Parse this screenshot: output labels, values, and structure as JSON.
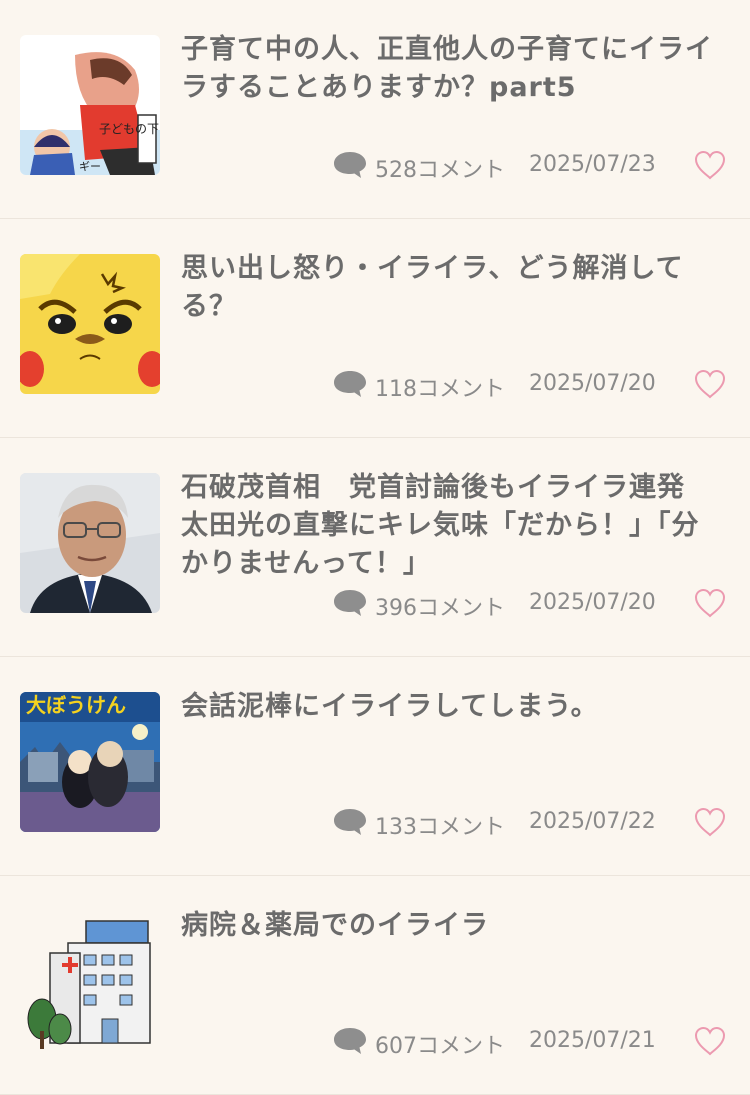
{
  "topics": [
    {
      "title": "子育て中の人、正直他人の子育てにイライラすることありますか？part5",
      "comments": "528コメント",
      "date": "2025/07/23",
      "thumbnail": "manga-illustration",
      "thumb_text": "子どもの下ネタに"
    },
    {
      "title": "思い出し怒り・イライラ、どう解消してる？",
      "comments": "118コメント",
      "date": "2025/07/20",
      "thumbnail": "angry-yellow-character"
    },
    {
      "title": "石破茂首相　党首討論後もイライラ連発　太田光の直撃にキレ気味「だから！」「分かりませんって！」",
      "comments": "396コメント",
      "date": "2025/07/20",
      "thumbnail": "politician-photo"
    },
    {
      "title": "会話泥棒にイライラしてしまう。",
      "comments": "133コメント",
      "date": "2025/07/22",
      "thumbnail": "anime-book-cover"
    },
    {
      "title": "病院＆薬局でのイライラ",
      "comments": "607コメント",
      "date": "2025/07/21",
      "thumbnail": "hospital-building-illustration"
    }
  ],
  "colors": {
    "background": "#fbf6ef",
    "title": "#6b6b6b",
    "meta": "#8a8a8a",
    "heart": "#ec9ab0",
    "comment_icon": "#8e8e8e"
  },
  "icons": {
    "comment": "comment-bubble-icon",
    "favorite": "heart-outline-icon"
  }
}
